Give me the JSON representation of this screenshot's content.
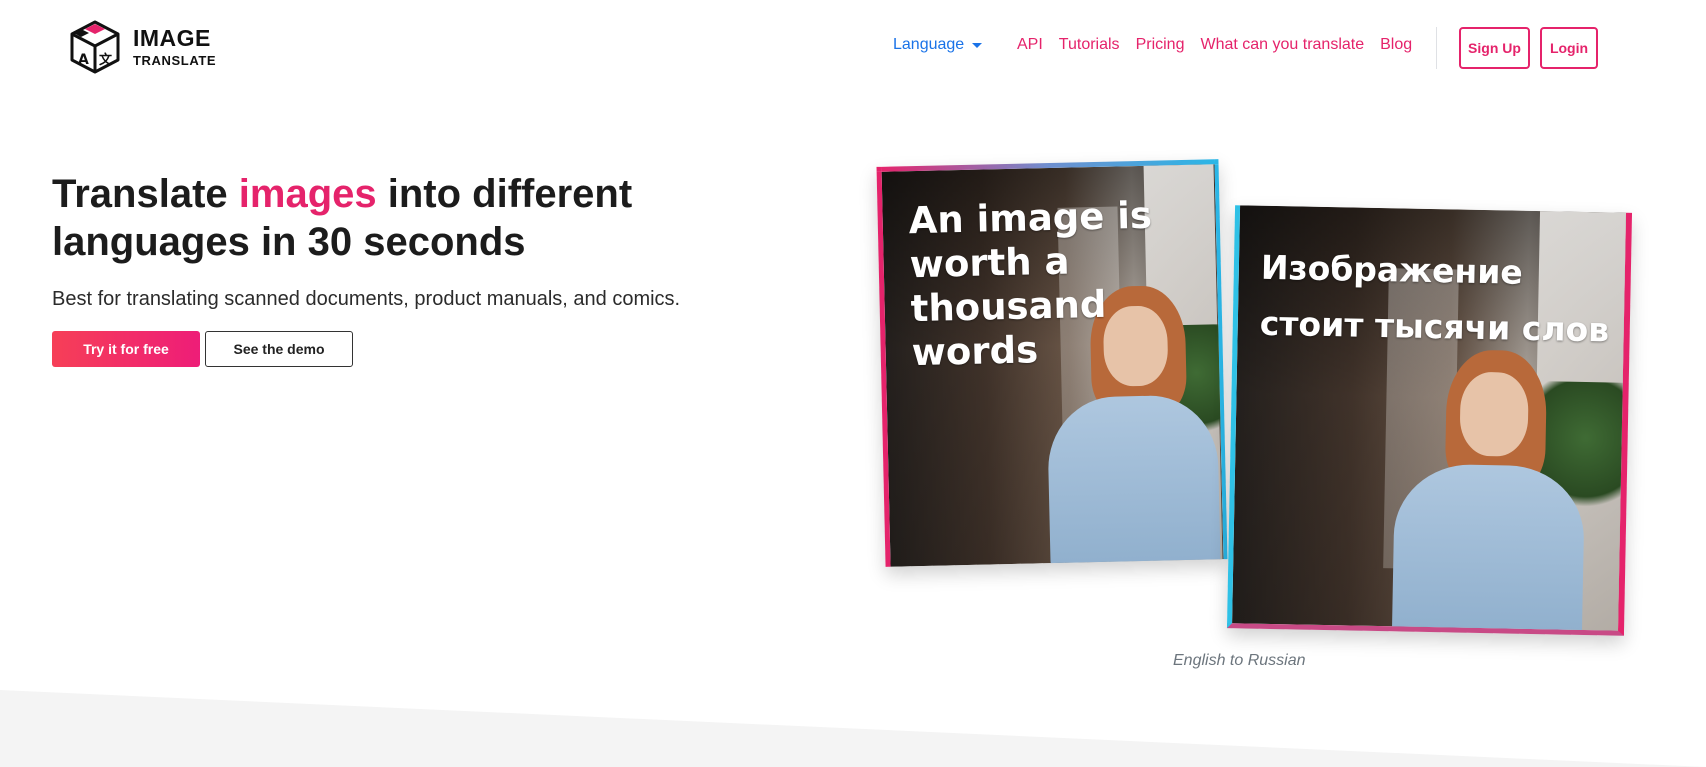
{
  "brand": {
    "line1": "IMAGE",
    "line2": "TRANSLATE",
    "logo_icon": "translate-cube-icon"
  },
  "nav": {
    "language_label": "Language",
    "links": [
      "API",
      "Tutorials",
      "Pricing",
      "What can you translate",
      "Blog"
    ],
    "signup_label": "Sign Up",
    "login_label": "Login"
  },
  "hero": {
    "title_before": "Translate ",
    "title_accent": "images",
    "title_after": " into different languages in 30 seconds",
    "subtitle": "Best for translating scanned documents, product manuals, and comics.",
    "primary_cta": "Try it for free",
    "secondary_cta": "See the demo"
  },
  "showcase": {
    "source_text": "An image is worth a thousand words",
    "translated_text": "Изображение стоит тысячи слов",
    "caption": "English to Russian"
  },
  "colors": {
    "accent": "#e5236b",
    "language_link": "#1a73e8",
    "cta_start": "#f63f57",
    "cta_end": "#ee1d78"
  }
}
